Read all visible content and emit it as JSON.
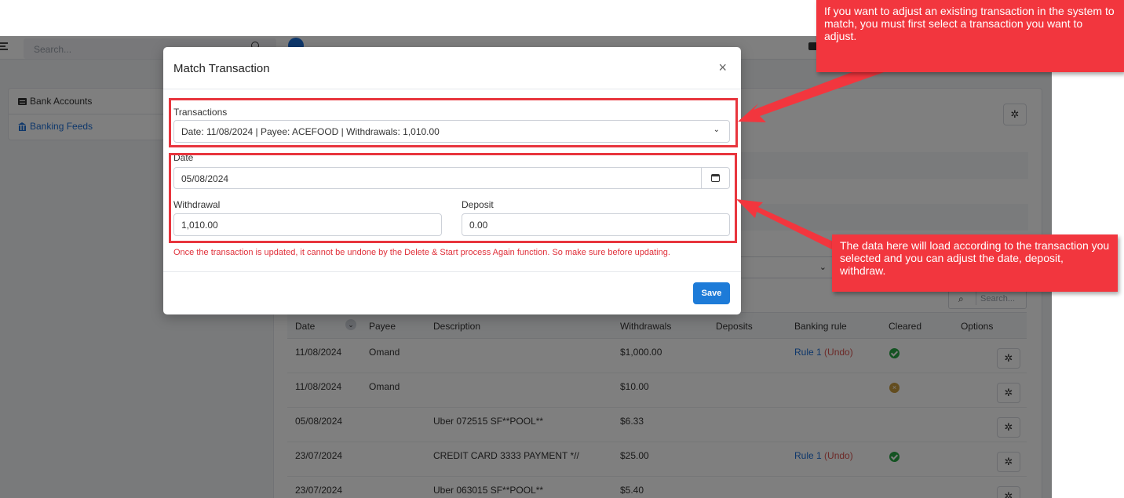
{
  "app": {
    "search_placeholder": "Search...",
    "sidebar": {
      "items": [
        {
          "label": "Bank Accounts",
          "icon": "list-icon"
        },
        {
          "label": "Banking Feeds",
          "icon": "bank-icon"
        }
      ]
    },
    "select_chevron": "⌄",
    "table_search_placeholder": "Search...",
    "table": {
      "columns": [
        "Date",
        "Payee",
        "Description",
        "Withdrawals",
        "Deposits",
        "Banking rule",
        "Cleared",
        "Options"
      ],
      "rows": [
        {
          "date": "11/08/2024",
          "payee": "Omand",
          "description": "",
          "withdrawals": "$1,000.00",
          "deposits": "",
          "rule": "Rule 1",
          "undo": "(Undo)",
          "cleared": "ok"
        },
        {
          "date": "11/08/2024",
          "payee": "Omand",
          "description": "",
          "withdrawals": "$10.00",
          "deposits": "",
          "rule": "",
          "undo": "",
          "cleared": "x"
        },
        {
          "date": "05/08/2024",
          "payee": "",
          "description": "Uber 072515 SF**POOL**",
          "withdrawals": "$6.33",
          "deposits": "",
          "rule": "",
          "undo": "",
          "cleared": ""
        },
        {
          "date": "23/07/2024",
          "payee": "",
          "description": "CREDIT CARD 3333 PAYMENT *//",
          "withdrawals": "$25.00",
          "deposits": "",
          "rule": "Rule 1",
          "undo": "(Undo)",
          "cleared": "ok"
        },
        {
          "date": "23/07/2024",
          "payee": "",
          "description": "Uber 063015 SF**POOL**",
          "withdrawals": "$5.40",
          "deposits": "",
          "rule": "",
          "undo": "",
          "cleared": ""
        }
      ]
    }
  },
  "modal": {
    "title": "Match Transaction",
    "close_label": "×",
    "transactions_label": "Transactions",
    "transactions_value": "Date: 11/08/2024 | Payee: ACEFOOD | Withdrawals: 1,010.00",
    "date_label": "Date",
    "date_value": "05/08/2024",
    "withdrawal_label": "Withdrawal",
    "withdrawal_value": "1,010.00",
    "deposit_label": "Deposit",
    "deposit_value": "0.00",
    "warning": "Once the transaction is updated, it cannot be undone by the Delete & Start process Again function. So make sure before updating.",
    "save_label": "Save"
  },
  "callouts": {
    "top": "If you want to adjust an existing transaction in the system to match, you must first select a transaction you want to adjust.",
    "bottom": "The data here will load according to the transaction you selected and you can adjust the date, deposit, withdraw."
  },
  "colors": {
    "accent": "#1d7bd8",
    "callout": "#f2363e",
    "highlight": "#e8353d",
    "warning_text": "#e0303a"
  }
}
